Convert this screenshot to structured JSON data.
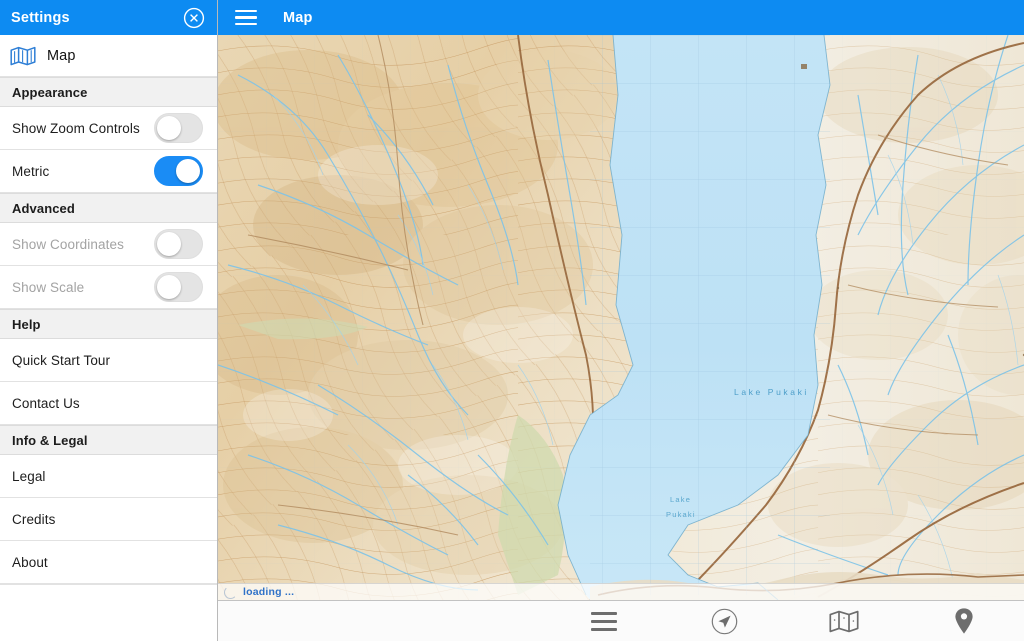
{
  "settings": {
    "header": {
      "title": "Settings",
      "close_icon": "close-circle-icon"
    },
    "map_item": {
      "label": "Map",
      "icon": "folded-map-icon"
    },
    "sections": [
      {
        "header": "Appearance",
        "rows": [
          {
            "label": "Show Zoom Controls",
            "type": "toggle",
            "value": "off",
            "disabled": false
          },
          {
            "label": "Metric",
            "type": "toggle",
            "value": "on",
            "disabled": false
          }
        ]
      },
      {
        "header": "Advanced",
        "rows": [
          {
            "label": "Show Coordinates",
            "type": "toggle",
            "value": "off",
            "disabled": true
          },
          {
            "label": "Show Scale",
            "type": "toggle",
            "value": "off",
            "disabled": true
          }
        ]
      },
      {
        "header": "Help",
        "rows": [
          {
            "label": "Quick Start Tour",
            "type": "link"
          },
          {
            "label": "Contact Us",
            "type": "link"
          }
        ]
      },
      {
        "header": "Info & Legal",
        "rows": [
          {
            "label": "Legal",
            "type": "link"
          },
          {
            "label": "Credits",
            "type": "link"
          },
          {
            "label": "About",
            "type": "link"
          }
        ]
      }
    ]
  },
  "map": {
    "header": {
      "title": "Map",
      "menu_icon": "hamburger-icon"
    },
    "status": {
      "text": "loading ...",
      "icon": "spinner-icon"
    },
    "labels": {
      "lake_primary": "Lake Pukaki",
      "lake_secondary": "Lake Pukaki"
    },
    "toolbar": [
      {
        "icon": "hamburger-icon",
        "name": "menu"
      },
      {
        "icon": "navigation-arrow-icon",
        "name": "locate"
      },
      {
        "icon": "folded-map-icon",
        "name": "layers"
      },
      {
        "icon": "location-pin-icon",
        "name": "waypoint"
      }
    ]
  },
  "colors": {
    "accent_blue": "#0d8bf2",
    "toggle_on": "#1a8cf5",
    "toggle_off": "#e4e4e4",
    "water": "#bfe2f5",
    "land_light": "#f0ece2",
    "land_tan": "#e3c89c",
    "contour": "#c79a63",
    "road": "#9a6b41",
    "stream": "#7dc3e8",
    "status_text": "#2f72c8"
  }
}
